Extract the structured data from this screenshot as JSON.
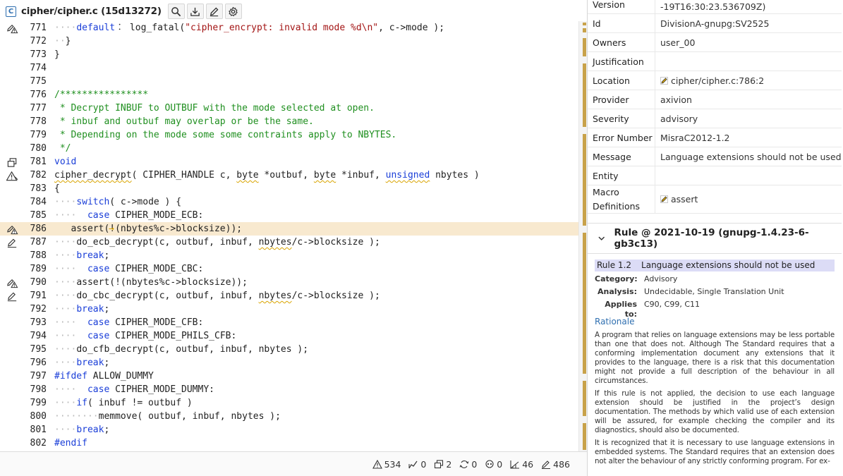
{
  "toolbar": {
    "file_letter": "C",
    "title": "cipher/cipher.c  (15d13272)",
    "icons": [
      "search-icon",
      "download-icon",
      "edit-icon",
      "gear-icon"
    ]
  },
  "code": {
    "lines": [
      {
        "no": "771",
        "icon": "edit-warning",
        "hl": false,
        "tokens": [
          [
            "ws",
            "····"
          ],
          [
            "kw",
            "default"
          ],
          [
            "",
            "︰ log_fatal("
          ],
          [
            "str",
            "\"cipher_encrypt: invalid mode %d\\n\""
          ],
          [
            "",
            ", c->mode );"
          ]
        ]
      },
      {
        "no": "772",
        "icon": "",
        "hl": false,
        "tokens": [
          [
            "ws",
            "··"
          ],
          [
            "",
            "}"
          ]
        ]
      },
      {
        "no": "773",
        "icon": "",
        "hl": false,
        "tokens": [
          [
            "",
            "}"
          ]
        ]
      },
      {
        "no": "774",
        "icon": "",
        "hl": false,
        "tokens": []
      },
      {
        "no": "775",
        "icon": "",
        "hl": false,
        "tokens": []
      },
      {
        "no": "776",
        "icon": "",
        "hl": false,
        "tokens": [
          [
            "cm",
            "/****************"
          ]
        ]
      },
      {
        "no": "777",
        "icon": "",
        "hl": false,
        "tokens": [
          [
            "cm",
            " * Decrypt INBUF to OUTBUF with the mode selected at open."
          ]
        ]
      },
      {
        "no": "778",
        "icon": "",
        "hl": false,
        "tokens": [
          [
            "cm",
            " * inbuf and outbuf may overlap or be the same."
          ]
        ]
      },
      {
        "no": "779",
        "icon": "",
        "hl": false,
        "tokens": [
          [
            "cm",
            " * Depending on the mode some some contraints apply to NBYTES."
          ]
        ]
      },
      {
        "no": "780",
        "icon": "",
        "hl": false,
        "tokens": [
          [
            "cm",
            " */"
          ]
        ]
      },
      {
        "no": "781",
        "icon": "copy",
        "hl": false,
        "tokens": [
          [
            "kw",
            "void"
          ]
        ]
      },
      {
        "no": "782",
        "icon": "warning",
        "hl": false,
        "tokens": [
          [
            "sq",
            "cipher_decrypt"
          ],
          [
            "",
            "( CIPHER_HANDLE c, "
          ],
          [
            "sq",
            "byte"
          ],
          [
            "",
            ""
          ],
          [
            "",
            " *outbuf, "
          ],
          [
            "sq",
            "byte"
          ],
          [
            "",
            " *inbuf, "
          ],
          [
            "kw sq",
            "unsigned"
          ],
          [
            "",
            " nbytes )"
          ]
        ]
      },
      {
        "no": "783",
        "icon": "",
        "hl": false,
        "tokens": [
          [
            "",
            "{"
          ]
        ]
      },
      {
        "no": "784",
        "icon": "",
        "hl": false,
        "tokens": [
          [
            "ws",
            "····"
          ],
          [
            "kw",
            "switch"
          ],
          [
            "",
            "( c->mode ) {"
          ]
        ]
      },
      {
        "no": "785",
        "icon": "",
        "hl": false,
        "tokens": [
          [
            "ws",
            "····"
          ],
          [
            "",
            "  "
          ],
          [
            "kw",
            "case"
          ],
          [
            "",
            " CIPHER_MODE_ECB:"
          ]
        ]
      },
      {
        "no": "786",
        "icon": "edit-warning",
        "hl": true,
        "tokens": [
          [
            "arrow",
            "→"
          ],
          [
            "",
            "   assert(!(nbytes%c->blocksize));"
          ]
        ]
      },
      {
        "no": "787",
        "icon": "edit",
        "hl": false,
        "tokens": [
          [
            "ws",
            "····"
          ],
          [
            "",
            "do_ecb_decrypt(c, outbuf, inbuf, "
          ],
          [
            "sq",
            "nbytes"
          ],
          [
            "",
            "/c->blocksize );"
          ]
        ]
      },
      {
        "no": "788",
        "icon": "",
        "hl": false,
        "tokens": [
          [
            "ws",
            "····"
          ],
          [
            "kw",
            "break"
          ],
          [
            "",
            ";"
          ]
        ]
      },
      {
        "no": "789",
        "icon": "",
        "hl": false,
        "tokens": [
          [
            "ws",
            "····"
          ],
          [
            "",
            "  "
          ],
          [
            "kw",
            "case"
          ],
          [
            "",
            " CIPHER_MODE_CBC:"
          ]
        ]
      },
      {
        "no": "790",
        "icon": "edit-warning",
        "hl": false,
        "tokens": [
          [
            "ws",
            "····"
          ],
          [
            "",
            "assert(!(nbytes%c->blocksize));"
          ]
        ]
      },
      {
        "no": "791",
        "icon": "edit",
        "hl": false,
        "tokens": [
          [
            "ws",
            "····"
          ],
          [
            "",
            "do_cbc_decrypt(c, outbuf, inbuf, "
          ],
          [
            "sq",
            "nbytes"
          ],
          [
            "",
            "/c->blocksize );"
          ]
        ]
      },
      {
        "no": "792",
        "icon": "",
        "hl": false,
        "tokens": [
          [
            "ws",
            "····"
          ],
          [
            "kw",
            "break"
          ],
          [
            "",
            ";"
          ]
        ]
      },
      {
        "no": "793",
        "icon": "",
        "hl": false,
        "tokens": [
          [
            "ws",
            "····"
          ],
          [
            "",
            "  "
          ],
          [
            "kw",
            "case"
          ],
          [
            "",
            " CIPHER_MODE_CFB:"
          ]
        ]
      },
      {
        "no": "794",
        "icon": "",
        "hl": false,
        "tokens": [
          [
            "ws",
            "····"
          ],
          [
            "",
            "  "
          ],
          [
            "kw",
            "case"
          ],
          [
            "",
            " CIPHER_MODE_PHILS_CFB:"
          ]
        ]
      },
      {
        "no": "795",
        "icon": "",
        "hl": false,
        "tokens": [
          [
            "ws",
            "····"
          ],
          [
            "",
            "do_cfb_decrypt(c, outbuf, inbuf, nbytes );"
          ]
        ]
      },
      {
        "no": "796",
        "icon": "",
        "hl": false,
        "tokens": [
          [
            "ws",
            "····"
          ],
          [
            "kw",
            "break"
          ],
          [
            "",
            ";"
          ]
        ]
      },
      {
        "no": "797",
        "icon": "",
        "hl": false,
        "tokens": [
          [
            "kw",
            "#ifdef"
          ],
          [
            "",
            " ALLOW_DUMMY"
          ]
        ]
      },
      {
        "no": "798",
        "icon": "",
        "hl": false,
        "tokens": [
          [
            "ws",
            "····"
          ],
          [
            "",
            "  "
          ],
          [
            "kw",
            "case"
          ],
          [
            "",
            " CIPHER_MODE_DUMMY:"
          ]
        ]
      },
      {
        "no": "799",
        "icon": "",
        "hl": false,
        "tokens": [
          [
            "ws",
            "····"
          ],
          [
            "kw",
            "if"
          ],
          [
            "",
            "( inbuf != outbuf )"
          ]
        ]
      },
      {
        "no": "800",
        "icon": "",
        "hl": false,
        "tokens": [
          [
            "ws",
            "········"
          ],
          [
            "",
            "memmove( outbuf, inbuf, nbytes );"
          ]
        ]
      },
      {
        "no": "801",
        "icon": "",
        "hl": false,
        "tokens": [
          [
            "ws",
            "····"
          ],
          [
            "kw",
            "break"
          ],
          [
            "",
            ";"
          ]
        ]
      },
      {
        "no": "802",
        "icon": "",
        "hl": false,
        "tokens": [
          [
            "kw",
            "#endif"
          ]
        ]
      }
    ]
  },
  "status": [
    {
      "icon": "warning-icon",
      "value": "534"
    },
    {
      "icon": "trend-icon",
      "value": "0"
    },
    {
      "icon": "copy-icon",
      "value": "2"
    },
    {
      "icon": "cycle-icon",
      "value": "0"
    },
    {
      "icon": "skull-icon",
      "value": "0"
    },
    {
      "icon": "metric-icon",
      "value": "46"
    },
    {
      "icon": "edit-icon",
      "value": "486"
    }
  ],
  "props": [
    {
      "key": "Version",
      "value": "-19T16:30:23.536709Z)",
      "icon": ""
    },
    {
      "key": "Id",
      "value": "DivisionA-gnupg:SV2525",
      "icon": ""
    },
    {
      "key": "Owners",
      "value": "user_00",
      "icon": ""
    },
    {
      "key": "Justification",
      "value": "",
      "icon": ""
    },
    {
      "key": "Location",
      "value": "cipher/cipher.c:786:2",
      "icon": "edit-icon"
    },
    {
      "key": "Provider",
      "value": "axivion",
      "icon": ""
    },
    {
      "key": "Severity",
      "value": "advisory",
      "icon": ""
    },
    {
      "key": "Error Number",
      "value": "MisraC2012-1.2",
      "icon": ""
    },
    {
      "key": "Message",
      "value": "Language extensions should not be used",
      "icon": ""
    },
    {
      "key": "Entity",
      "value": "",
      "icon": ""
    },
    {
      "key": "Macro Definitions",
      "value": "assert",
      "icon": "edit-icon"
    }
  ],
  "rule": {
    "header": "Rule @ 2021-10-19 (gnupg-1.4.23-6-gb3c13)",
    "number": "Rule 1.2",
    "title": "Language extensions should not be used",
    "category_label": "Category:",
    "category": "Advisory",
    "analysis_label": "Analysis:",
    "analysis": "Undecidable, Single Translation Unit",
    "applies_label": "Applies to:",
    "applies": "C90, C99, C11",
    "rationale_head": "Rationale",
    "paragraphs": [
      "A program that relies on language extensions may be less portable than one that does not. Although The Standard requires that a conforming implementation document any extensions that it provides to the language, there is a risk that this documentation might not provide a full description of the behaviour in all circumstances.",
      "If this rule is not applied, the decision to use each language extension should be justified in the project’s design documentation. The methods by which valid use of each extension will be assured, for example checking the compiler and its diagnostics, should also be documented.",
      "It is recognized that it is necessary to use language extensions in embedded systems. The Standard requires that an extension does not alter the behaviour of any strictly conforming program. For ex-"
    ]
  }
}
